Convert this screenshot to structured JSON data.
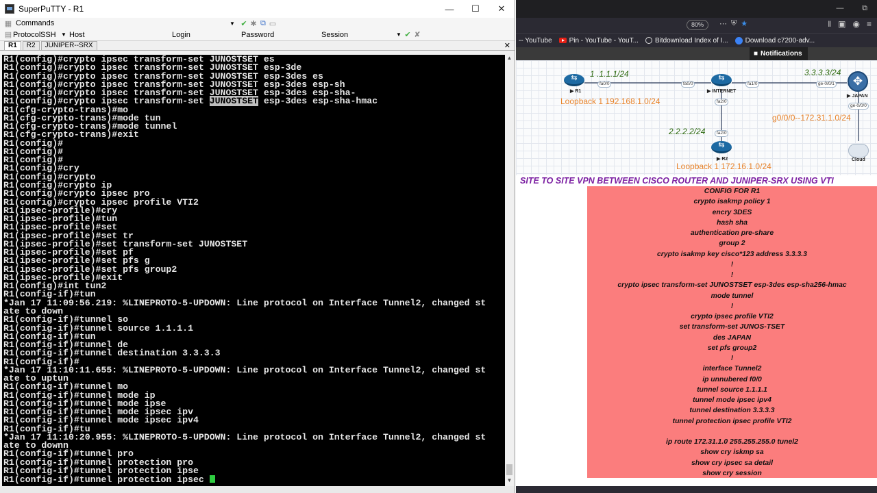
{
  "putty": {
    "title": "SuperPuTTY - R1",
    "commands_label": "Commands",
    "protocol_label": "Protocol",
    "protocol_value": "SSH",
    "host_label": "Host",
    "login_label": "Login",
    "password_label": "Password",
    "session_label": "Session",
    "tabs": [
      "R1",
      "R2",
      "JUNIPER--SRX"
    ],
    "terminal_lines": [
      "R1(config)#crypto ipsec transform-set JUNOSTSET es",
      "R1(config)#crypto ipsec transform-set JUNOSTSET esp-3de",
      "R1(config)#crypto ipsec transform-set JUNOSTSET esp-3des es",
      "R1(config)#crypto ipsec transform-set JUNOSTSET esp-3des esp-sh",
      "R1(config)#crypto ipsec transform-set JUNOSTSET esp-3des esp-sha-",
      "R1(config)#crypto ipsec transform-set JUNOSTSET esp-3des esp-sha-hmac",
      "R1(cfg-crypto-trans)#mo",
      "R1(cfg-crypto-trans)#mode tun",
      "R1(cfg-crypto-trans)#mode tunnel",
      "R1(cfg-crypto-trans)#exit",
      "R1(config)#",
      "R1(config)#",
      "R1(config)#",
      "R1(config)#cry",
      "R1(config)#crypto",
      "R1(config)#crypto ip",
      "R1(config)#crypto ipsec pro",
      "R1(config)#crypto ipsec profile VTI2",
      "R1(ipsec-profile)#cry",
      "R1(ipsec-profile)#tun",
      "R1(ipsec-profile)#set",
      "R1(ipsec-profile)#set tr",
      "R1(ipsec-profile)#set transform-set JUNOSTSET",
      "R1(ipsec-profile)#set pf",
      "R1(ipsec-profile)#set pfs g",
      "R1(ipsec-profile)#set pfs group2",
      "R1(ipsec-profile)#exit",
      "R1(config)#int tun2",
      "R1(config-if)#tun",
      "*Jan 17 11:09:56.219: %LINEPROTO-5-UPDOWN: Line protocol on Interface Tunnel2, changed st",
      "ate to down",
      "R1(config-if)#tunnel so",
      "R1(config-if)#tunnel source 1.1.1.1",
      "R1(config-if)#tun",
      "R1(config-if)#tunnel de",
      "R1(config-if)#tunnel destination 3.3.3.3",
      "R1(config-if)#",
      "*Jan 17 11:10:11.655: %LINEPROTO-5-UPDOWN: Line protocol on Interface Tunnel2, changed st",
      "ate to uptun",
      "R1(config-if)#tunnel mo",
      "R1(config-if)#tunnel mode ip",
      "R1(config-if)#tunnel mode ipse",
      "R1(config-if)#tunnel mode ipsec ipv",
      "R1(config-if)#tunnel mode ipsec ipv4",
      "R1(config-if)#tu",
      "*Jan 17 11:10:20.955: %LINEPROTO-5-UPDOWN: Line protocol on Interface Tunnel2, changed st",
      "ate to downn",
      "R1(config-if)#tunnel pro",
      "R1(config-if)#tunnel protection pro",
      "R1(config-if)#tunnel protection ipse",
      "R1(config-if)#tunnel protection ipsec "
    ],
    "highlight_line": 5,
    "highlight_text": "JUNOSTSET"
  },
  "browser": {
    "zoom": "80%",
    "bookmarks": [
      "-- YouTube",
      "Pin - YouTube - YouT...",
      "Bitdownload Index of I...",
      "Download c7200-adv..."
    ],
    "notifications_label": "Notifications"
  },
  "diagram": {
    "nodes": {
      "r1": "R1",
      "internet": "INTERNET",
      "r2": "R2",
      "japan": "JAPAN",
      "cloud": "Cloud"
    },
    "interfaces": {
      "r1_fa": "fa0/0",
      "inet_left": "fa0/0",
      "inet_right": "fa1/0",
      "inet_down": "fa2/0",
      "r2_up": "fa2/0",
      "jp_left": "ge-0/0/1",
      "jp_down": "ge-0/0/0"
    },
    "ip_r1": "1 .1.1.1/24",
    "ip_r3": "3.3.3.3/24",
    "ip_r2": "2.2.2.2/24",
    "lo_r1": "Loopback 1 192.168.1.0/24",
    "g0": "g0/0/0--172.31.1.0/24",
    "lo_r2": "Loopback 1 172.16.1.0/24"
  },
  "heading": "SITE TO SITE VPN BETWEEN CISCO ROUTER AND JUNIPER-SRX USING VTI",
  "config_lines": [
    "CONFIG FOR R1",
    "crypto isakmp policy 1",
    "encry 3DES",
    "hash sha",
    "authentication pre-share",
    "group 2",
    "crypto isakmp key cisco*123 address 3.3.3.3",
    "!",
    "!",
    "crypto ipsec transform-set JUNOSTSET esp-3des esp-sha256-hmac",
    "mode tunnel",
    "!",
    "crypto ipsec profile VTI2",
    "set transform-set JUNOS-TSET",
    "des JAPAN",
    "set pfs group2",
    "!",
    "interface Tunnel2",
    "ip unnubered f0/0",
    "tunnel source 1.1.1.1",
    "tunnel mode ipsec ipv4",
    "tunnel destination 3.3.3.3",
    "tunnel protection ipsec profile VTI2",
    "",
    "ip route 172.31.1.0 255.255.255.0 tunel2",
    "show cry iskmp sa",
    "show cry ipsec sa detail",
    "show cry session"
  ]
}
